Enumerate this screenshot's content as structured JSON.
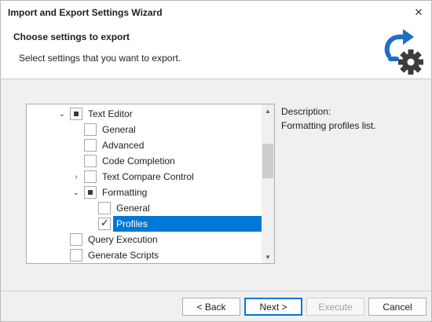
{
  "window": {
    "title": "Import and Export Settings Wizard",
    "close_glyph": "✕"
  },
  "header": {
    "title": "Choose settings to export",
    "subtitle": "Select settings that you want to export.",
    "icon": "export-settings-gear-icon",
    "icon_colors": {
      "arrow": "#1e6ec8",
      "gear": "#3c3c3c"
    }
  },
  "tree": {
    "items": [
      {
        "label": "Text Editor",
        "expander": "expanded",
        "check": "partial",
        "level": 0
      },
      {
        "label": "General",
        "expander": "none",
        "check": "unchecked",
        "level": 1
      },
      {
        "label": "Advanced",
        "expander": "none",
        "check": "unchecked",
        "level": 1
      },
      {
        "label": "Code Completion",
        "expander": "none",
        "check": "unchecked",
        "level": 1
      },
      {
        "label": "Text Compare Control",
        "expander": "collapsed",
        "check": "unchecked",
        "level": 1
      },
      {
        "label": "Formatting",
        "expander": "expanded",
        "check": "partial",
        "level": 1
      },
      {
        "label": "General",
        "expander": "none",
        "check": "unchecked",
        "level": 2
      },
      {
        "label": "Profiles",
        "expander": "none",
        "check": "checked",
        "level": 2,
        "selected": true
      },
      {
        "label": "Query Execution",
        "expander": "none",
        "check": "unchecked",
        "level": 0
      },
      {
        "label": "Generate Scripts",
        "expander": "none",
        "check": "unchecked",
        "level": 0
      }
    ],
    "selection_color": "#0078d7"
  },
  "description": {
    "label": "Description:",
    "text": "Formatting profiles list."
  },
  "buttons": {
    "back": "< Back",
    "next": "Next >",
    "execute": "Execute",
    "cancel": "Cancel"
  }
}
